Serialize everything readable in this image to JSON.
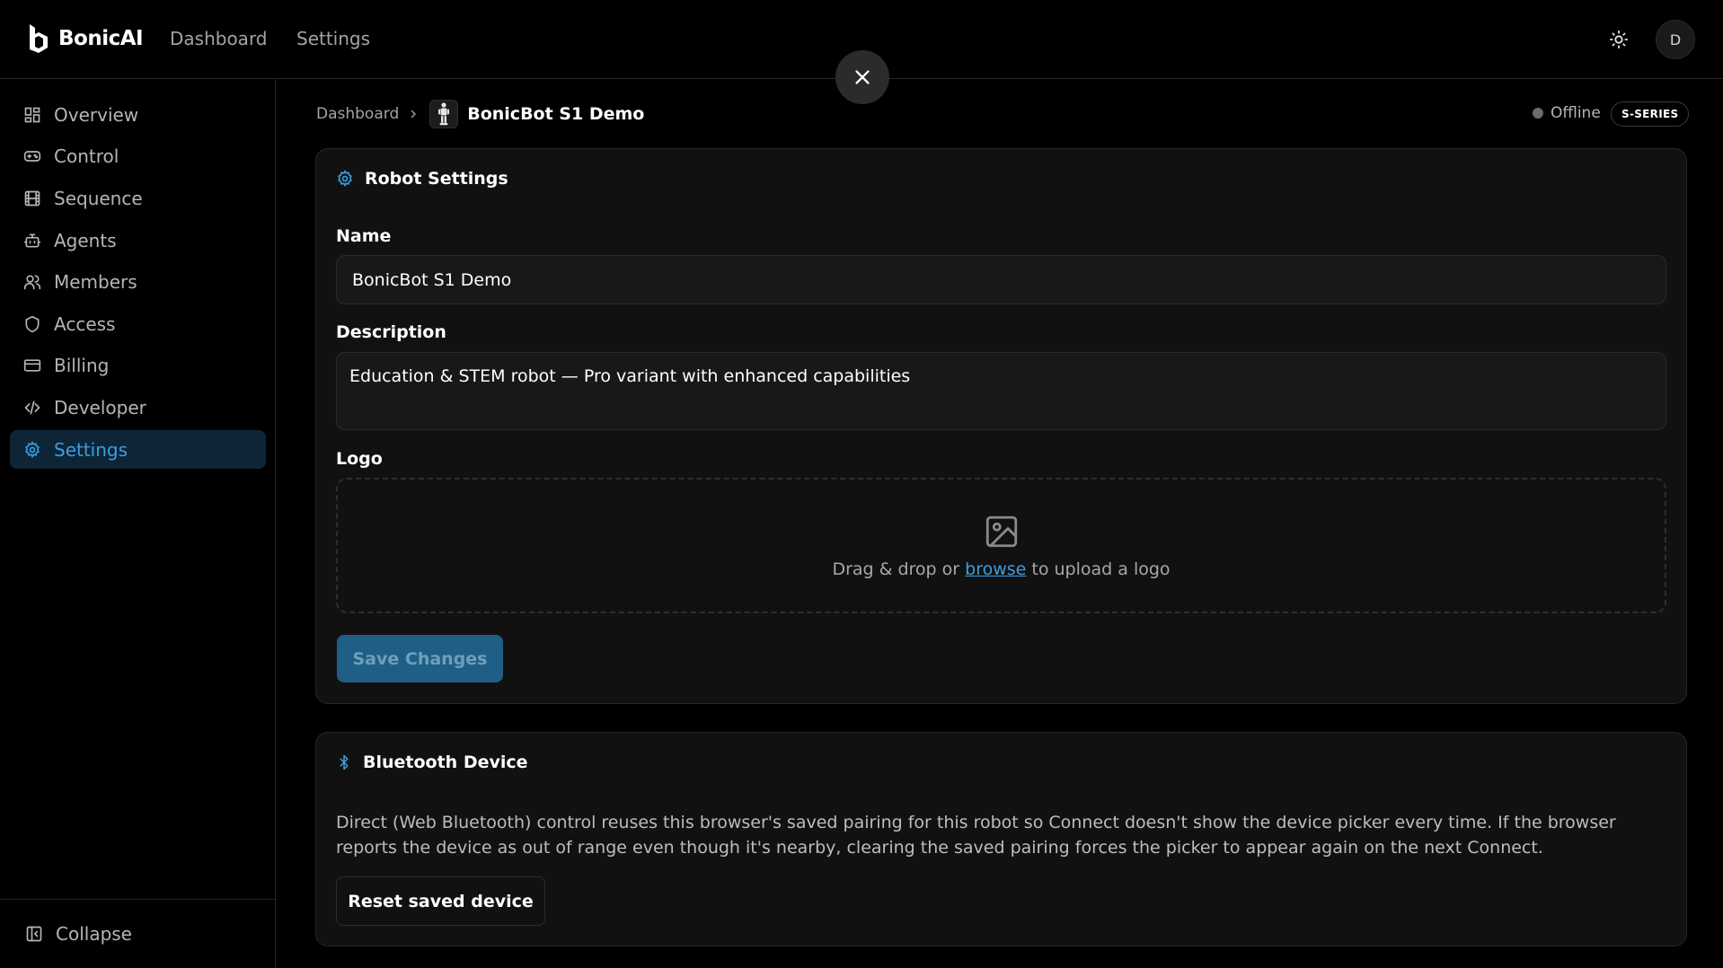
{
  "app": {
    "brand": "BonicAI"
  },
  "topnav": {
    "dashboard": "Dashboard",
    "settings": "Settings"
  },
  "user": {
    "avatar_initial": "D"
  },
  "sidebar": {
    "items": [
      {
        "label": "Overview",
        "icon": "grid-icon"
      },
      {
        "label": "Control",
        "icon": "gamepad-icon"
      },
      {
        "label": "Sequence",
        "icon": "film-icon"
      },
      {
        "label": "Agents",
        "icon": "bot-icon"
      },
      {
        "label": "Members",
        "icon": "users-icon"
      },
      {
        "label": "Access",
        "icon": "shield-icon"
      },
      {
        "label": "Billing",
        "icon": "credit-card-icon"
      },
      {
        "label": "Developer",
        "icon": "code-icon"
      },
      {
        "label": "Settings",
        "icon": "gear-icon",
        "active": true
      }
    ],
    "collapse_label": "Collapse"
  },
  "breadcrumb": {
    "root": "Dashboard",
    "current": "BonicBot S1 Demo"
  },
  "status": {
    "label": "Offline",
    "series": "S-SERIES"
  },
  "robot_settings": {
    "title": "Robot Settings",
    "name_label": "Name",
    "name_value": "BonicBot S1 Demo",
    "description_label": "Description",
    "description_value": "Education & STEM robot — Pro variant with enhanced capabilities",
    "logo_label": "Logo",
    "dropzone": {
      "prefix": "Drag & drop or",
      "link": "browse",
      "suffix": "to upload a logo"
    },
    "save_label": "Save Changes"
  },
  "bluetooth": {
    "title": "Bluetooth Device",
    "description": "Direct (Web Bluetooth) control reuses this browser's saved pairing for this robot so Connect doesn't show the device picker every time. If the browser reports the device as out of range even though it's nearby, clearing the saved pairing forces the picker to appear again on the next Connect.",
    "reset_label": "Reset saved device"
  },
  "colors": {
    "accent": "#3b9ee3",
    "active_bg": "#0d2536",
    "save_bg": "#1f5f86"
  }
}
